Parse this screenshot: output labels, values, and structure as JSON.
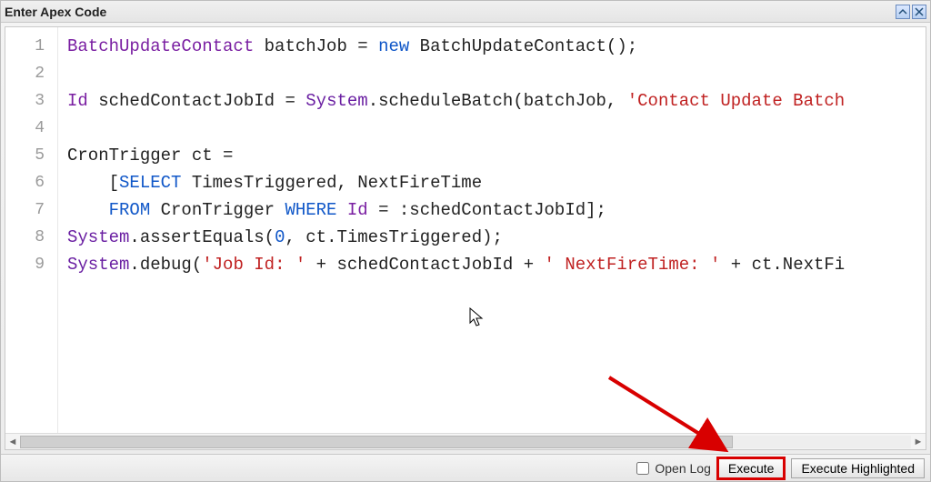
{
  "titlebar": {
    "title": "Enter Apex Code"
  },
  "gutter": {
    "lines": [
      "1",
      "2",
      "3",
      "4",
      "5",
      "6",
      "7",
      "8",
      "9"
    ]
  },
  "code": {
    "l1_a": "BatchUpdateContact",
    "l1_b": " batchJob = ",
    "l1_c": "new",
    "l1_d": " BatchUpdateContact();",
    "l3_a": "Id",
    "l3_b": " schedContactJobId = ",
    "l3_c": "System",
    "l3_d": ".scheduleBatch(batchJob, ",
    "l3_e": "'Contact Update Batch",
    "l5_a": "CronTrigger ct =",
    "l6_a": "    [",
    "l6_b": "SELECT",
    "l6_c": " TimesTriggered, NextFireTime",
    "l7_a": "    ",
    "l7_b": "FROM",
    "l7_c": " CronTrigger ",
    "l7_d": "WHERE",
    "l7_e": " ",
    "l7_f": "Id",
    "l7_g": " = :schedContactJobId];",
    "l8_a": "System",
    "l8_b": ".assertEquals(",
    "l8_c": "0",
    "l8_d": ", ct.TimesTriggered);",
    "l9_a": "System",
    "l9_b": ".debug(",
    "l9_c": "'Job Id: '",
    "l9_d": " + schedContactJobId + ",
    "l9_e": "' NextFireTime: '",
    "l9_f": " + ct.NextFi"
  },
  "footer": {
    "open_log_label": "Open Log",
    "execute_label": "Execute",
    "execute_highlighted_label": "Execute Highlighted"
  }
}
